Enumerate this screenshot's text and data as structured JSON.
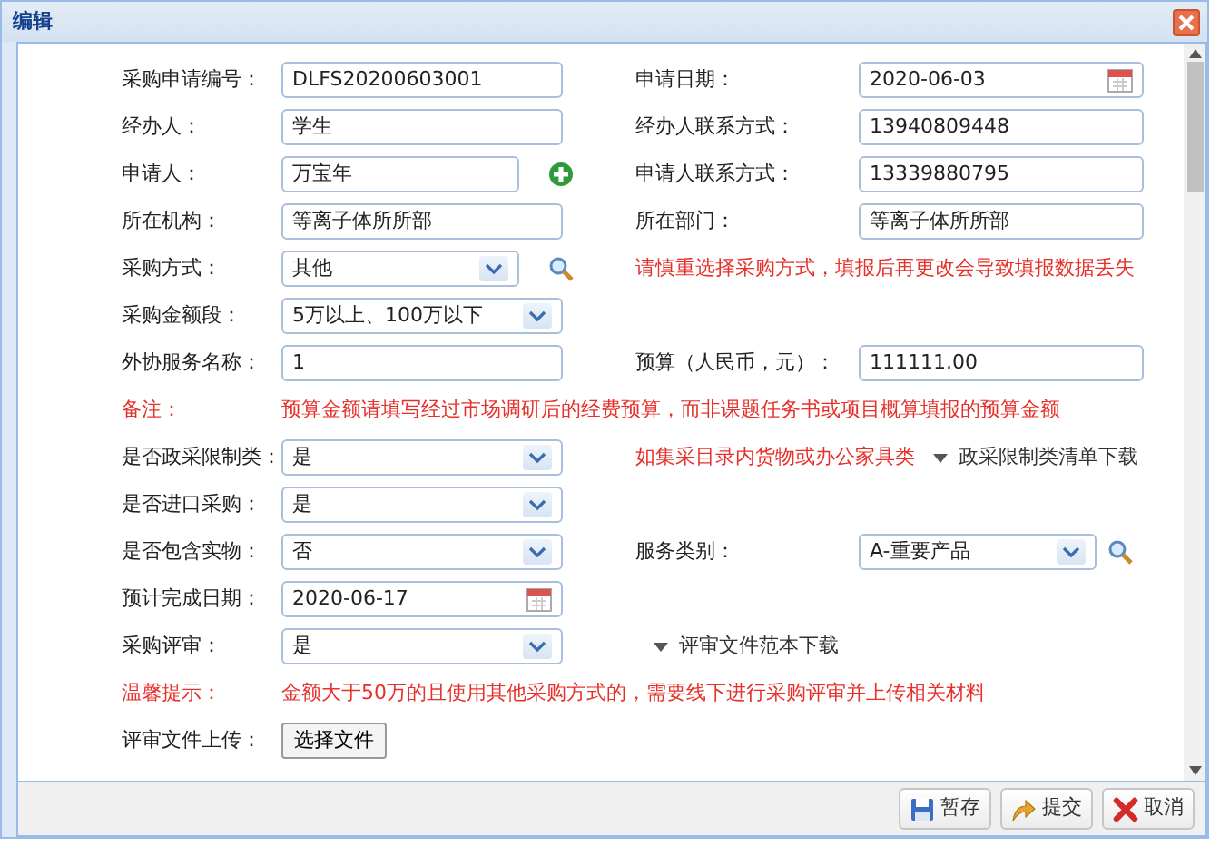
{
  "window": {
    "title": "编辑"
  },
  "rows": [
    {
      "kind": "form",
      "label": "采购申请编号：",
      "field": {
        "kind": "text",
        "value": "DLFS20200603001"
      },
      "right": [
        {
          "kind": "label",
          "text": "申请日期："
        },
        {
          "kind": "field",
          "field": {
            "kind": "date",
            "value": "2020-06-03"
          }
        }
      ]
    },
    {
      "kind": "form",
      "label": "经办人：",
      "field": {
        "kind": "text",
        "value": "学生"
      },
      "right": [
        {
          "kind": "label",
          "text": "经办人联系方式："
        },
        {
          "kind": "field",
          "field": {
            "kind": "text",
            "value": "13940809448"
          }
        }
      ]
    },
    {
      "kind": "form",
      "label": "申请人：",
      "field": {
        "kind": "text",
        "value": "万宝年",
        "add_button": true
      },
      "right": [
        {
          "kind": "label",
          "text": "申请人联系方式："
        },
        {
          "kind": "field",
          "field": {
            "kind": "text",
            "value": "13339880795"
          }
        }
      ]
    },
    {
      "kind": "form",
      "label": "所在机构：",
      "field": {
        "kind": "text",
        "value": "等离子体所所部"
      },
      "right": [
        {
          "kind": "label",
          "text": "所在部门："
        },
        {
          "kind": "field",
          "field": {
            "kind": "text",
            "value": "等离子体所所部"
          }
        }
      ]
    },
    {
      "kind": "form",
      "label": "采购方式：",
      "field": {
        "kind": "select",
        "value": "其他",
        "search_button": true
      },
      "right": [
        {
          "kind": "note",
          "text": "请慎重选择采购方式，填报后再更改会导致填报数据丢失"
        }
      ]
    },
    {
      "kind": "form",
      "label": "采购金额段：",
      "field": {
        "kind": "select",
        "value": "5万以上、100万以下"
      }
    },
    {
      "kind": "form",
      "label": "外协服务名称：",
      "field": {
        "kind": "text",
        "value": "1"
      },
      "right": [
        {
          "kind": "label",
          "text": "预算（人民币，元）："
        },
        {
          "kind": "field",
          "field": {
            "kind": "text",
            "value": "111111.00"
          }
        }
      ]
    },
    {
      "kind": "notice",
      "label": "备注：",
      "text": "预算金额请填写经过市场调研后的经费预算，而非课题任务书或项目概算填报的预算金额"
    },
    {
      "kind": "form",
      "label": "是否政采限制类：",
      "field": {
        "kind": "select",
        "value": "是"
      },
      "right": [
        {
          "kind": "note",
          "text": "如集采目录内货物或办公家具类"
        },
        {
          "kind": "link",
          "text": "政采限制类清单下载"
        }
      ]
    },
    {
      "kind": "form",
      "label": "是否进口采购：",
      "field": {
        "kind": "select",
        "value": "是"
      }
    },
    {
      "kind": "form",
      "label": "是否包含实物：",
      "field": {
        "kind": "select",
        "value": "否"
      },
      "right": [
        {
          "kind": "label",
          "text": "服务类别："
        },
        {
          "kind": "field",
          "field": {
            "kind": "select",
            "value": "A-重要产品",
            "search_button": true
          }
        }
      ]
    },
    {
      "kind": "form",
      "label": "预计完成日期：",
      "field": {
        "kind": "date",
        "value": "2020-06-17"
      }
    },
    {
      "kind": "form",
      "label": "采购评审：",
      "field": {
        "kind": "select",
        "value": "是"
      },
      "right": [
        {
          "kind": "link",
          "text": "评审文件范本下载"
        }
      ]
    },
    {
      "kind": "notice",
      "label": "温馨提示：",
      "text": "金额大于50万的且使用其他采购方式的，需要线下进行采购评审并上传相关材料"
    },
    {
      "kind": "form",
      "label": "评审文件上传：",
      "field": {
        "kind": "file",
        "value": "选择文件"
      }
    }
  ],
  "buttons": [
    {
      "kind": "save",
      "label": "暂存"
    },
    {
      "kind": "submit",
      "label": "提交"
    },
    {
      "kind": "cancel",
      "label": "取消"
    }
  ]
}
